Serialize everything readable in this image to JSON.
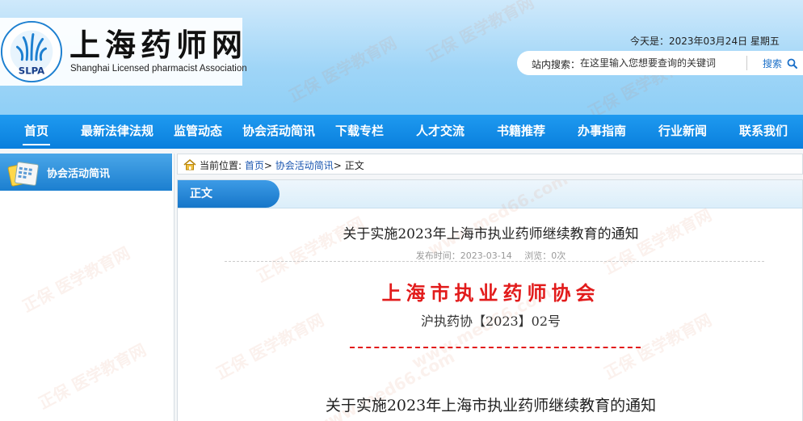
{
  "site": {
    "title": "上海药师网",
    "subtitle": "Shanghai Licensed pharmacist Association",
    "logo_ring_text": "上海市执业药师协会",
    "logo_abbr": "SLPA"
  },
  "header": {
    "date_text": "今天是：2023年03月24日  星期五",
    "search_label": "站内搜索：",
    "search_placeholder": "在这里输入您想要查询的关键词",
    "search_button": "搜索"
  },
  "nav": {
    "items": [
      {
        "label": "首页"
      },
      {
        "label": "最新法律法规"
      },
      {
        "label": "监管动态"
      },
      {
        "label": "协会活动简讯"
      },
      {
        "label": "下载专栏"
      },
      {
        "label": "人才交流"
      },
      {
        "label": "书籍推荐"
      },
      {
        "label": "办事指南"
      },
      {
        "label": "行业新闻"
      },
      {
        "label": "联系我们"
      }
    ]
  },
  "sidebar": {
    "title": "协会活动简讯"
  },
  "breadcrumb": {
    "prefix": "当前位置:",
    "home": "首页",
    "sep1": ">",
    "section": "协会活动简讯",
    "sep2": ">",
    "current": "正文"
  },
  "content": {
    "tab_label": "正文",
    "article_title": "关于实施2023年上海市执业药师继续教育的通知",
    "publish_label": "发布时间：2023-03-14",
    "views_label": "浏览：0次",
    "org_name": "上海市执业药师协会",
    "doc_number": "沪执药协【2023】02号",
    "body_title": "关于实施2023年上海市执业药师继续教育的通知"
  },
  "watermark": {
    "text": "正保 医学教育网",
    "url": "www.med66.com"
  },
  "colors": {
    "nav_blue": "#0a7fdd",
    "accent_red": "#e21b1b",
    "link_blue": "#1a56b0"
  }
}
